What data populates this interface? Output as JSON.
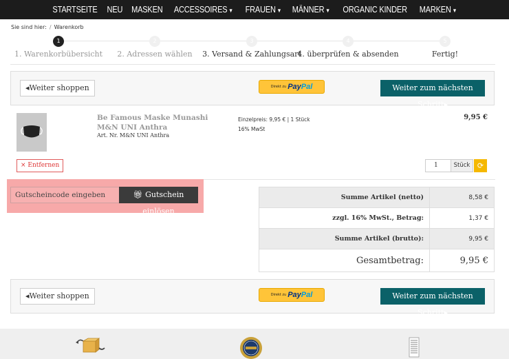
{
  "nav": {
    "items": [
      {
        "label": "STARTSEITE",
        "has_dropdown": false
      },
      {
        "label": "NEU",
        "has_dropdown": false
      },
      {
        "label": "MASKEN",
        "has_dropdown": false
      },
      {
        "label": "ACCESSOIRES",
        "has_dropdown": true
      },
      {
        "label": "FRAUEN",
        "has_dropdown": true
      },
      {
        "label": "MÄNNER",
        "has_dropdown": true
      },
      {
        "label": "ORGANIC KINDER",
        "has_dropdown": false
      },
      {
        "label": "MARKEN",
        "has_dropdown": true
      }
    ]
  },
  "breadcrumb": {
    "prefix": "Sie sind hier:",
    "separator": "/",
    "current": "Warenkorb"
  },
  "steps": [
    {
      "number": "1",
      "label": "1. Warenkorbübersicht"
    },
    {
      "number": "2",
      "label": "2. Adressen wählen"
    },
    {
      "number": "3",
      "label": "3. Versand & Zahlungsart"
    },
    {
      "number": "4",
      "label": "4. überprüfen & absenden"
    },
    {
      "number": "5",
      "label": "Fertig!"
    }
  ],
  "actions": {
    "continue_shopping": "Weiter shoppen",
    "paypal_small": "Direkt zu",
    "paypal_pay": "Pay",
    "paypal_pal": "Pal",
    "next_step": "Weiter zum nächsten Schritt"
  },
  "product": {
    "title": "Be Famous Maske Munashi M&N UNI Anthra",
    "art_nr": "Art. Nr. M&N UNI Anthra",
    "unit_price": "Einzelpreis: 9,95 € | 1 Stück",
    "tax": "16% MwSt",
    "price": "9,95 €",
    "remove": "× Entfernen",
    "quantity": "1",
    "quantity_unit": "Stück"
  },
  "coupon": {
    "placeholder": "Gutscheincode eingeben",
    "button": "Gutschein einlösen"
  },
  "totals": [
    {
      "label": "Summe Artikel (netto)",
      "value": "8,58 €"
    },
    {
      "label": "zzgl. 16% MwSt., Betrag:",
      "value": "1,37 €"
    },
    {
      "label": "Summe Artikel (brutto):",
      "value": "9,95 €"
    },
    {
      "label": "Gesamtbetrag:",
      "value": "9,95 €"
    }
  ],
  "colors": {
    "primary": "#0b6168",
    "paypal": "#ffc439",
    "highlight": "#f7a9a9"
  }
}
